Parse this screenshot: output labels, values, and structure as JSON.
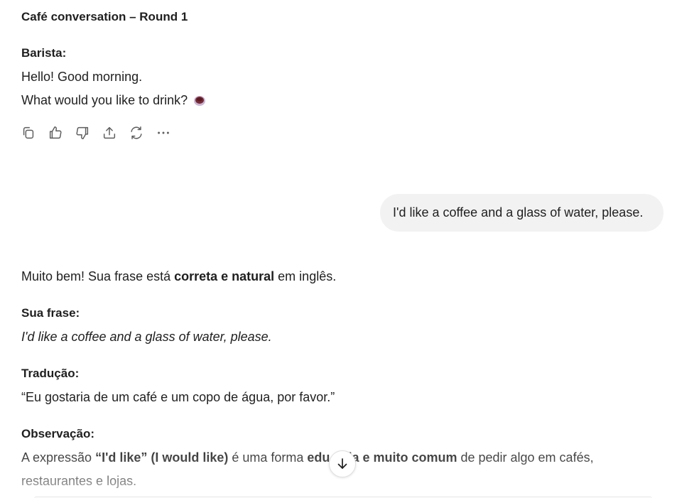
{
  "title": "Café conversation – Round 1",
  "assistant_turn": {
    "speaker": "Barista:",
    "line1": "Hello! Good morning.",
    "line2": "What would you like to drink?",
    "emoji": "coffee-cup-emoji"
  },
  "actions": {
    "icons": [
      "copy-icon",
      "thumbs-up-icon",
      "thumbs-down-icon",
      "share-icon",
      "regenerate-icon",
      "more-icon"
    ]
  },
  "user_message": "I'd like a coffee and a glass of water, please.",
  "response": {
    "intro_pre": "Muito bem! Sua frase está ",
    "intro_bold": "correta e natural",
    "intro_post": " em inglês.",
    "sentence_heading": "Sua frase:",
    "sentence": "I'd like a coffee and a glass of water, please.",
    "translation_heading": "Tradução:",
    "translation": "“Eu gostaria de um café e um copo de água, por favor.”",
    "note_heading": "Observação:",
    "note_pre": "A expressão ",
    "note_bold1": "“I'd like” (I would like)",
    "note_mid": " é uma forma ",
    "note_bold2a": "edu",
    "note_bold2b": "la e muito comum",
    "note_post": " de pedir algo em cafés,",
    "note_line2": "restaurantes e lojas."
  },
  "colors": {
    "text": "#1f1f1f",
    "bubble_bg": "#f2f2f2",
    "icon": "#5d5d5d"
  }
}
